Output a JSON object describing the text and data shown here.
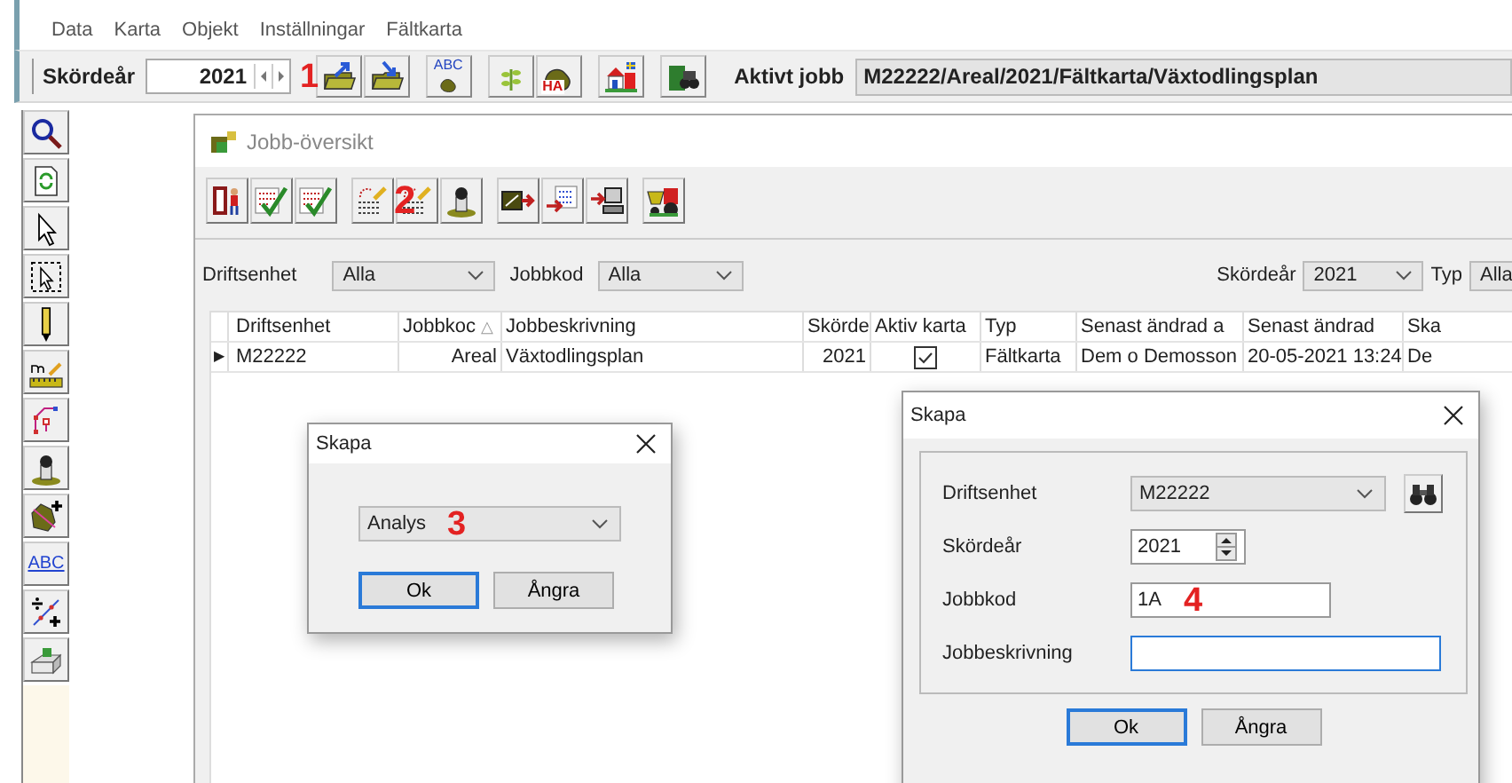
{
  "menu": [
    "Data",
    "Karta",
    "Objekt",
    "Inställningar",
    "Fältkarta"
  ],
  "toolbar": {
    "year_label": "Skördeår",
    "year": "2021",
    "callout": "1",
    "buttons": [
      {
        "kind": "folder-up"
      },
      {
        "kind": "folder-down"
      },
      {
        "kind": "abc-map",
        "label": "ABC"
      },
      {
        "kind": "sprout"
      },
      {
        "kind": "ha-map",
        "label": "HA"
      },
      {
        "kind": "farm"
      },
      {
        "kind": "binocular-map"
      }
    ],
    "active_label": "Aktivt jobb",
    "active_value": "M22222/Areal/2021/Fältkarta/Växtodlingsplan"
  },
  "tool_strip": [
    {
      "kind": "search"
    },
    {
      "kind": "refresh"
    },
    {
      "kind": "pointer"
    },
    {
      "kind": "select-rect"
    },
    {
      "kind": "pencil"
    },
    {
      "kind": "measure"
    },
    {
      "kind": "nodes"
    },
    {
      "kind": "stamp"
    },
    {
      "kind": "polygon-add"
    },
    {
      "kind": "abc",
      "label": "ABC"
    },
    {
      "kind": "split"
    },
    {
      "kind": "printer"
    }
  ],
  "job_window": {
    "title": "Jobb-översikt",
    "callout": "2",
    "toolbar_groups": [
      [
        {
          "kind": "door"
        },
        {
          "kind": "checklist"
        },
        {
          "kind": "checklist"
        }
      ],
      [
        {
          "kind": "table-edit"
        },
        {
          "kind": "table-edit"
        },
        {
          "kind": "stamp"
        }
      ],
      [
        {
          "kind": "map-arrow"
        },
        {
          "kind": "list-arrow"
        },
        {
          "kind": "computer-arrow"
        }
      ],
      [
        {
          "kind": "tractor"
        }
      ]
    ],
    "filters_left": [
      {
        "label": "Driftsenhet",
        "value": "Alla"
      },
      {
        "label": "Jobbkod",
        "value": "Alla"
      }
    ],
    "filters_right": [
      {
        "label": "Skördeår",
        "value": "2021"
      },
      {
        "label": "Typ",
        "value": "Alla"
      }
    ],
    "table": {
      "columns": [
        {
          "label": "Driftsenhet"
        },
        {
          "label": "Jobbkoc",
          "sort": "△"
        },
        {
          "label": "Jobbeskrivning"
        },
        {
          "label": "Skörde"
        },
        {
          "label": "Aktiv karta"
        },
        {
          "label": "Typ"
        },
        {
          "label": "Senast ändrad a"
        },
        {
          "label": "Senast ändrad"
        },
        {
          "label": "Ska"
        }
      ],
      "rows": [
        {
          "marker": "▶",
          "driftsenhet": "M22222",
          "jobbkod": "Areal",
          "beskrivning": "Växtodlingsplan",
          "year": "2021",
          "active": true,
          "typ": "Fältkarta",
          "changed_by": "Dem o Demosson",
          "changed": "20-05-2021 13:24",
          "column_9": "De"
        }
      ]
    }
  },
  "dialog_small": {
    "title": "Skapa",
    "select": "Analys",
    "callout": "3",
    "buttons": [
      {
        "label": "Ok",
        "default": true
      },
      {
        "label": "Ångra",
        "default": false
      }
    ]
  },
  "dialog_large": {
    "title": "Skapa",
    "fields": [
      {
        "kind": "select",
        "label": "Driftsenhet",
        "value": "M22222"
      },
      {
        "kind": "spin",
        "label": "Skördeår",
        "value": "2021"
      },
      {
        "kind": "text",
        "label": "Jobbkod",
        "value": "1A",
        "callout": "4",
        "focused": false
      },
      {
        "kind": "text",
        "label": "Jobbeskrivning",
        "focused": true
      }
    ],
    "buttons": [
      {
        "label": "Ok",
        "default": true
      },
      {
        "label": "Ångra",
        "default": false
      }
    ]
  }
}
